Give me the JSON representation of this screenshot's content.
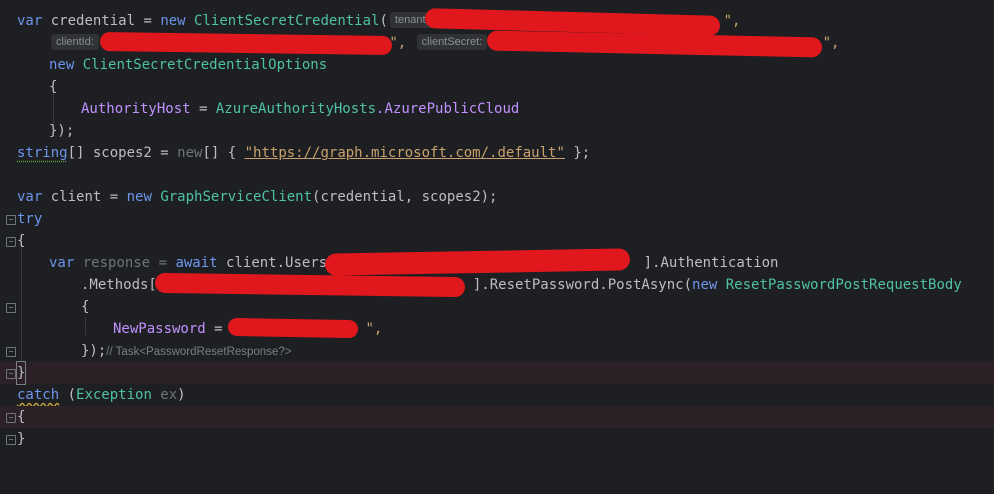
{
  "code": {
    "l1": {
      "kw": "var",
      "name": " credential = ",
      "new": "new",
      "cls": " ClientSecretCredential",
      "paren": "(",
      "hint": "tenantId:",
      "str": " \"",
      "tail": "\","
    },
    "l2": {
      "hint1": "clientId:",
      "str1": "\"",
      "mid": "\", ",
      "hint2": "clientSecret:",
      "str2": "\"",
      "tail": "\","
    },
    "l3": {
      "new": "new",
      "cls": " ClientSecretCredentialOptions"
    },
    "l4": {
      "text": "{"
    },
    "l5": {
      "prop": "AuthorityHost",
      "eq": " = ",
      "cls": "AzureAuthorityHosts",
      "rest": ".AzurePublicCloud"
    },
    "l6": {
      "text": "});"
    },
    "l7": {
      "kw": "string",
      "rest": "[] scopes2 = ",
      "new": "new",
      "rest2": "[] { ",
      "str": "\"https://graph.microsoft.com/.default\"",
      "end": " };"
    },
    "l9": {
      "kw": "var",
      "name": " client = ",
      "new": "new",
      "cls": " GraphServiceClient",
      "args": "(credential, scopes2);"
    },
    "l10": {
      "kw": "try"
    },
    "l11": {
      "text": "{"
    },
    "l12": {
      "kw": "var",
      "name": " response = ",
      "await": "await",
      "obj": " client.Users[",
      "tail": "].Authentication"
    },
    "l13": {
      "pre": ".Methods[",
      "mid": "].ResetPassword.PostAsync(",
      "new": "new",
      "cls": " ResetPasswordPostRequestBody"
    },
    "l14": {
      "text": "{"
    },
    "l15": {
      "prop": "NewPassword",
      "eq": " = ",
      "str": "\"",
      "tail": "\","
    },
    "l16": {
      "text": "});",
      "hint": "// Task<PasswordResetResponse?>"
    },
    "l17": {
      "text": "}"
    },
    "l18": {
      "kw": "catch",
      "rest": " (",
      "cls": "Exception",
      "var": " ex",
      ")": ")"
    },
    "l19": {
      "text": "{"
    },
    "l20": {
      "text": "}"
    }
  },
  "colors": {
    "background": "#1e1f22",
    "keyword": "#6c95eb",
    "class": "#4fc1a6",
    "string": "#c9a26d",
    "redaction": "#e0181d"
  }
}
